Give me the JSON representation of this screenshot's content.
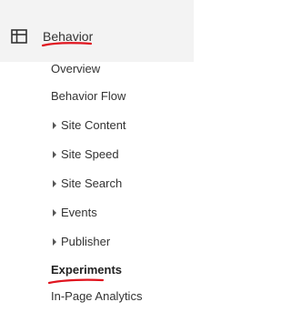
{
  "section": {
    "icon": "layout-grid-icon",
    "label": "Behavior",
    "annotation_color": "#e0141e"
  },
  "menu": {
    "items": [
      {
        "label": "Overview",
        "expandable": false
      },
      {
        "label": "Behavior Flow",
        "expandable": false
      },
      {
        "label": "Site Content",
        "expandable": true,
        "icon": "caret-right-icon"
      },
      {
        "label": "Site Speed",
        "expandable": true,
        "icon": "caret-right-icon"
      },
      {
        "label": "Site Search",
        "expandable": true,
        "icon": "caret-right-icon"
      },
      {
        "label": "Events",
        "expandable": true,
        "icon": "caret-right-icon"
      },
      {
        "label": "Publisher",
        "expandable": true,
        "icon": "caret-right-icon"
      },
      {
        "label": "Experiments",
        "expandable": false,
        "active": true
      },
      {
        "label": "In-Page Analytics",
        "expandable": false
      }
    ]
  }
}
